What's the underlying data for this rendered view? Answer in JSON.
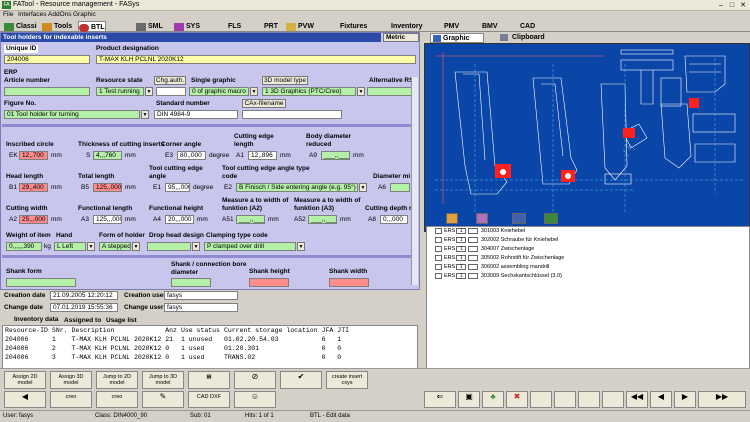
{
  "window": {
    "title": "FATool - Resource management - FASys"
  },
  "menu": [
    "File",
    "Interfaces",
    "AddOns",
    "Graphic"
  ],
  "tabs": [
    "Classi",
    "Tools",
    "BTL",
    "SML",
    "SYS",
    "FLS",
    "PRT",
    "PVW",
    "Fixtures",
    "Inventory",
    "PMV",
    "BMV",
    "CAD"
  ],
  "panel": {
    "header": "Tool holders for indexable inserts",
    "metric": "Metric",
    "unique_id_label": "Unique ID",
    "unique_id": "204006",
    "product_designation_label": "Product designation",
    "product_designation": "T-MAX KLH PCLNL 2020K12",
    "erp_label": "ERP",
    "article_number_label": "Article number",
    "resource_state_label": "Resource state",
    "resource_state": "1 Test running",
    "chg_auth": "Chg.auth.",
    "single_graphic_label": "Single graphic",
    "single_graphic": "0 of graphic macro",
    "model_type_btn": "3D model type",
    "model_type": "1 3D Graphics (PTC/Creo)",
    "alternative_rs_label": "Alternative RS",
    "figure_no_label": "Figure No.",
    "figure_no": "01 Tool holder for turning",
    "standard_number_label": "Standard number",
    "standard_number": "DIN 4984-9",
    "cax_filename": "CAx-filename"
  },
  "params": {
    "inscribed_circle": {
      "label": "Inscribed circle",
      "code": "EK",
      "value": "12,,700",
      "unit": "mm"
    },
    "thickness": {
      "label": "Thickness of cutting inserts",
      "code": "S",
      "value": "4,,,760",
      "unit": "mm"
    },
    "corner_angle": {
      "label": "Corner angle",
      "code": "E3",
      "value": "80,,000",
      "unit": "degree"
    },
    "cutting_edge_length": {
      "label": "Cutting edge length",
      "code": "A1",
      "value": "12,,896",
      "unit": "mm"
    },
    "body_diameter": {
      "label": "Body diameter reduced",
      "code": "A9",
      "value": "___,,___",
      "unit": "mm"
    },
    "head_length": {
      "label": "Head length",
      "code": "B1",
      "value": "29,,400",
      "unit": "mm"
    },
    "total_length": {
      "label": "Total length",
      "code": "B5",
      "value": "125,,000",
      "unit": "mm"
    },
    "tool_cutting_edge_angle": {
      "label": "Tool cutting edge angle",
      "code": "E1",
      "value": "95,,,000",
      "unit": "degree"
    },
    "tool_cutting_edge_code": {
      "label": "Tool cutting edge angle type code",
      "code": "E2",
      "value": "B Finisch / Side entering angle (e.g. 95°)"
    },
    "diameter_min": {
      "label": "Diameter mi",
      "code": "A6"
    },
    "cutting_width": {
      "label": "Cutting width",
      "code": "A2",
      "value": "25,,,000",
      "unit": "mm"
    },
    "functional_length": {
      "label": "Functional length",
      "code": "A3",
      "value": "125,,,000",
      "unit": "mm"
    },
    "functional_height": {
      "label": "Functional height",
      "code": "A4",
      "value": "20,,,000",
      "unit": "mm"
    },
    "measure_width_a2": {
      "label": "Measure a to width of funktion (A2)",
      "code": "A51",
      "value": "___,,___",
      "unit": "mm"
    },
    "measure_width_a3": {
      "label": "Measure a to width of funktion (A3)",
      "code": "A52",
      "value": "___,,___",
      "unit": "mm"
    },
    "cutting_depth": {
      "label": "Cutting depth m",
      "code": "A8",
      "value": "0,,,000",
      "unit": ""
    },
    "weight": {
      "label": "Weight of item",
      "value": "0,,,,,,390",
      "unit": "kg"
    },
    "hand": {
      "label": "Hand",
      "value": "L Left"
    },
    "holder_form": {
      "label": "Form of holder",
      "value": "A stepped"
    },
    "drop_head": {
      "label": "Drop head design"
    },
    "clamping": {
      "label": "Clamping type code",
      "value": "P clamped over drill"
    },
    "shank_form": {
      "label": "Shank form"
    },
    "shank_diameter": {
      "label": "Shank / connection bore diameter"
    },
    "shank_height": {
      "label": "Shank height"
    },
    "shank_width": {
      "label": "Shank width"
    }
  },
  "dates": {
    "creation_date_label": "Creation date",
    "creation_date": "21.09.2005 12:20:12",
    "creation_user_label": "Creation user",
    "creation_user": "fasys",
    "change_date_label": "Change date",
    "change_date": "07.01.2019 15:55:36",
    "change_user_label": "Change user",
    "change_user": "fasys"
  },
  "subtabs": [
    "Inventory data",
    "Assigned to",
    "Usage list"
  ],
  "inventory": {
    "headers": [
      "Resource-ID",
      "SNr.",
      "Description",
      "Anz",
      "Use status",
      "Current storage location",
      "JFA",
      "JTI"
    ],
    "rows": [
      [
        "204006",
        "1",
        "T-MAX KLH PCLNL 2020K12",
        "21",
        "1 unused",
        "01.02.20.54.03",
        "6",
        "1"
      ],
      [
        "204006",
        "2",
        "T-MAX KLH PCLNL 2020K12",
        "0",
        "1 used",
        "01.20.301",
        "0",
        "0"
      ],
      [
        "204006",
        "3",
        "T-MAX KLH PCLNL 2020K12",
        "0",
        "1 used",
        "TRANS.02",
        "0",
        "0"
      ]
    ]
  },
  "graphic_tabs": [
    "Graphic",
    "Clipboard"
  ],
  "components": [
    {
      "type": "ERS",
      "qty": "1",
      "id": "301003",
      "name": "Kniehebel"
    },
    {
      "type": "ERS",
      "qty": "1",
      "id": "302002",
      "name": "Schraube für Kniehebel"
    },
    {
      "type": "ERS",
      "qty": "1",
      "id": "304007",
      "name": "Zwischenlage"
    },
    {
      "type": "ERS",
      "qty": "1",
      "id": "305002",
      "name": "Rohrstift für Zwischenlage"
    },
    {
      "type": "ERS",
      "qty": "1",
      "id": "306002",
      "name": "assembling mandrill"
    },
    {
      "type": "ERS",
      "qty": "1",
      "id": "303009",
      "name": "Sechskantschlüssel (3.0)"
    }
  ],
  "toolbar": {
    "assign_2d": "Assign 2D model",
    "assign_3d": "Assign 3D model",
    "jump_2d": "Jump to 2D model",
    "jump_3d": "Jump to 3D model",
    "create_insert": "create insert csys",
    "creo": "creo",
    "cad_dxf": "CAD DXF"
  },
  "status": {
    "user": "User: fasys",
    "class": "Class: DIN4000_90",
    "sub": "Sub: 01",
    "hits": "Hits: 1 of 1",
    "mode": "BTL - Edit data"
  },
  "colors": {
    "header_blue": "#2b4ba8",
    "panel_lavender": "#c9c6ee",
    "graphic_bg": "#0a45a8",
    "field_green": "#b4f0a8",
    "field_yellow": "#ffffa8",
    "field_red": "#ff8c8c"
  }
}
